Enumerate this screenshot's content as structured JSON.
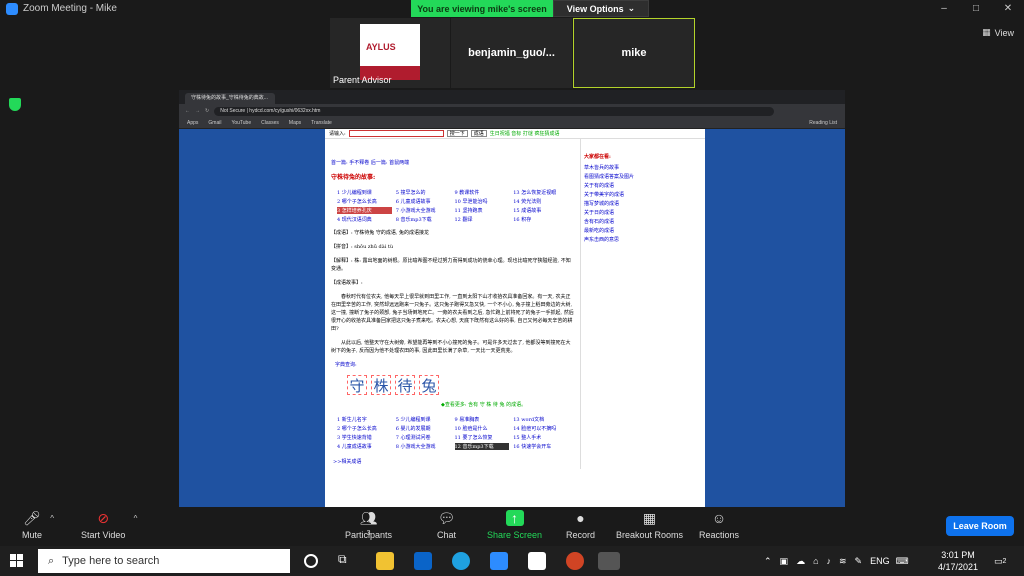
{
  "window": {
    "title": "Zoom Meeting - Mike",
    "controls": [
      "–",
      "□",
      "✕"
    ]
  },
  "viewing_bar": {
    "status": "You are viewing mike's screen",
    "options_label": "View Options",
    "options_icon": "chevron-down-icon"
  },
  "participants": [
    {
      "name": "Parent Advisor",
      "has_video": true,
      "logo_text": "AYLUS"
    },
    {
      "name": "benjamin_guo/...",
      "has_video": false
    },
    {
      "name": "mike",
      "has_video": false,
      "active_speaker": true
    }
  ],
  "view_button": {
    "label": "View"
  },
  "browser": {
    "tab_title": "守株待兔的故事_守株待兔的典故...",
    "url": "hydcd.com/cy/gushi/0632xx.htm",
    "url_prefix": "Not Secure",
    "bookmarks": [
      "Apps",
      "Gmail",
      "YouTube",
      "Classes",
      "Maps",
      "Translate"
    ],
    "reading_list": "Reading List"
  },
  "webpage": {
    "search_label": "请输入:",
    "search_button": "搜一下",
    "search_select": "成语",
    "top_links": "生日祝福  音标  打谜  疯狂猜成语",
    "nav_line": "首一篇: 手不释卷 后一篇: 首鼠两端",
    "story_title": "守株待兔的故事:",
    "link_grid": [
      "1 少儿编程到课",
      "5 撞早怎么的",
      "9 教课软件",
      "13 怎么恢复近视眼",
      "2 哪个子怎么长高",
      "6 儿童成语故事",
      "10 早泄能治吗",
      "14 荧光法则",
      "3 怎样培养孔庆",
      "7 小游戏大全游戏",
      "11 坚持跑表",
      "15 成语故事",
      "4 现代汉语词典",
      "8 音乐mp3下载",
      "12 翻译",
      "16 积存"
    ],
    "chengyu_line": "【成语】: 守株待兔  守的成语, 兔的成语接龙",
    "pinyin_line": "【拼音】: shǒu zhū dài tù",
    "explain_line": "【解释】: 株: 露出地面的树根。原比喻希图不经过努力而得到成功的侥幸心理。现也比喻死守狭隘经验, 不知变通。",
    "story_header": "【成语故事】:",
    "story_p1": "春秋时代有位农夫, 他每天早上很早就到田里工作, 一直到太阳下山才收拾农具准备回家。有一天, 农夫正在田里辛苦的工作, 突然却远远跑来一只兔子。这只兔子跑得又急又快, 一个不小心, 兔子撞上稻田旁边的大树, 这一撞, 撞断了兔子的颈部, 兔子当场倒地死亡。一旁的农夫看到之后, 急忙跑上前将死了的兔子一手抓起, 然后很开心的收拾农具准备回家把这只兔子煮来吃。农夫心想, 天底下既然有这么好的事, 自己又何必每天辛苦的耕田?",
    "story_p2": "从此以后, 他整天守在大树旁, 希望能再等到不小心撞死的兔子。可是许多天过去了, 他都没等到撞死在大树下的兔子, 反而因为他不处理农田的事, 因此田里长满了杂草, 一天比一天更荒芜。",
    "char_label": "字典查询:",
    "big_chars": [
      "守",
      "株",
      "待",
      "兔"
    ],
    "green_link": "◆查看更多: 含有 守 株 待 兔 的成语。",
    "link_grid2": [
      "1 新生儿名字",
      "5 少儿编程到课",
      "9 易准胸表",
      "13 word文档",
      "2 哪个子怎么长高",
      "6 婴儿的发展期",
      "10 脸痘是什么",
      "14 脸痘可以不摘吗",
      "3 学生快速背错",
      "7 心理测试问卷",
      "11 要了怎么恢复",
      "15 整人手术",
      "4 儿童成语故事",
      "8 小游戏大全游戏",
      "12 音乐mp3下载",
      "16 快速学会开车"
    ],
    "more": ">>相关成语",
    "right_header": "大家都在看:",
    "right_links": [
      "草木皆兵的故事",
      "看图猜成语答案及图片",
      "关于有的成语",
      "关于带美字的成语",
      "描写梦城的成语",
      "关于日的成语",
      "含有石的成语",
      "最新吃的成语",
      "声东击西的意思"
    ]
  },
  "toolbar": {
    "mute": "Mute",
    "start_video": "Start Video",
    "participants": "Participants",
    "participants_count": "3",
    "chat": "Chat",
    "share_screen": "Share Screen",
    "record": "Record",
    "breakout_rooms": "Breakout Rooms",
    "reactions": "Reactions",
    "leave": "Leave Room"
  },
  "taskbar": {
    "search_placeholder": "Type here to search",
    "language": "ENG",
    "time": "3:01 PM",
    "date": "4/17/2021",
    "notifications": "2"
  },
  "colors": {
    "zoom_green": "#23d959",
    "zoom_blue": "#0e72ed",
    "page_blue": "#1f52a1"
  }
}
